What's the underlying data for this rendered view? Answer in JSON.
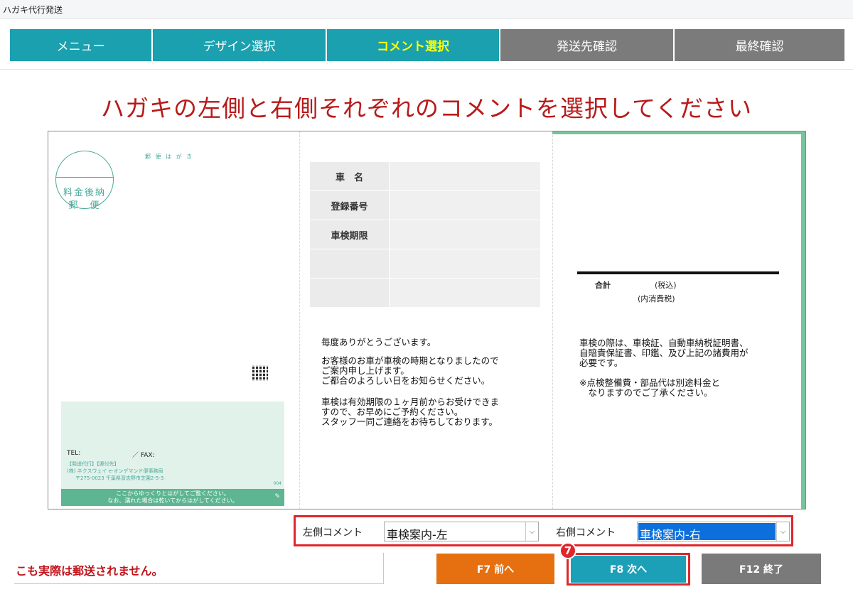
{
  "window": {
    "title": "ハガキ代行発送"
  },
  "tabs": [
    {
      "label": "メニュー",
      "state": "done"
    },
    {
      "label": "デザイン選択",
      "state": "done"
    },
    {
      "label": "コメント選択",
      "state": "active"
    },
    {
      "label": "発送先確認",
      "state": "pending"
    },
    {
      "label": "最終確認",
      "state": "pending"
    }
  ],
  "heading": "ハガキの左側と右側それぞれのコメントを選択してください",
  "postcard": {
    "stamp": {
      "line1": "料金後納",
      "line2": "郵　便"
    },
    "mark": "郵 便 は が き",
    "sender": {
      "tel": "TEL:",
      "fax": "／ FAX:",
      "line1": "【発送代行】【連付先】",
      "line2": "(株) ネクスウェイ e-オンデマンド便事務局",
      "line3": "〒275-0023 千葉県習志野市芝園2-5-3",
      "code": "004",
      "band1": "ここからゆっくりとはがしてご覧ください。",
      "band2": "なお、濡れた場合は乾いてからはがしてください。"
    },
    "table": [
      {
        "key": "車　名",
        "value": ""
      },
      {
        "key": "登録番号",
        "value": ""
      },
      {
        "key": "車検期限",
        "value": ""
      },
      {
        "key": "",
        "value": ""
      },
      {
        "key": "",
        "value": ""
      }
    ],
    "left_message": {
      "p1": "毎度ありがとうございます。",
      "p2a": "お客様のお車が車検の時期となりましたので",
      "p2b": "ご案内申し上げます。",
      "p2c": "ご都合のよろしい日をお知らせください。",
      "p3a": "車検は有効期限の１ヶ月前からお受けできま",
      "p3b": "すので、お早めにご予約ください。",
      "p3c": "スタッフ一同ご連絡をお待ちしております。"
    },
    "total": {
      "label": "合計",
      "tax": "(税込)",
      "incl": "(内消費税)"
    },
    "right_message": {
      "p1a": "車検の際は、車検証、自動車納税証明書、",
      "p1b": "自賠責保証書、印鑑、及び上記の諸費用が",
      "p1c": "必要です。",
      "p2a": "※点検整備費・部品代は別途料金と",
      "p2b": "　なりますのでご了承ください。"
    }
  },
  "selectors": {
    "left_label": "左側コメント",
    "left_value": "車検案内-左",
    "right_label": "右側コメント",
    "right_value": "車検案内-右"
  },
  "notice": "こも実際は郵送されません。",
  "buttons": {
    "prev": "F7 前へ",
    "next": "F8 次へ",
    "end": "F12 終了"
  },
  "step_badge": "7"
}
